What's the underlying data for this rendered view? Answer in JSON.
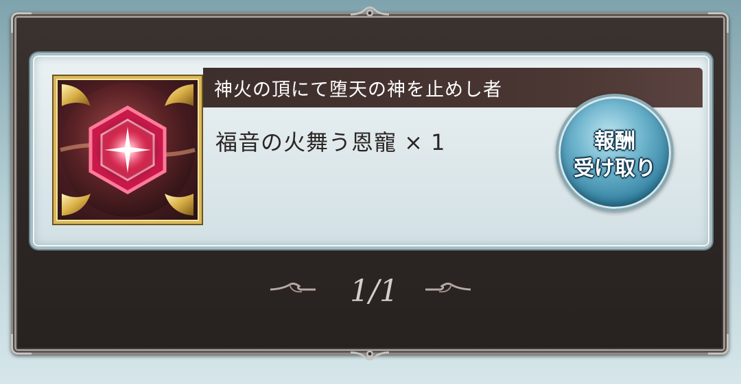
{
  "mission": {
    "title": "神火の頂にて堕天の神を止めし者",
    "reward_text": "福音の火舞う恩寵 × 1",
    "item_icon": "red-hexagon-gem-icon"
  },
  "claim_button": {
    "line1": "報酬",
    "line2": "受け取り"
  },
  "pager": {
    "indicator": "1/1",
    "prev_icon": "ornate-left-arrow-icon",
    "next_icon": "ornate-right-arrow-icon"
  },
  "colors": {
    "frame_dark": "#2c2624",
    "title_bar": "#3d2f2c",
    "card_light": "#dfe9ec",
    "button_blue": "#2f7e9f",
    "gold_border": "#d9b85a"
  }
}
